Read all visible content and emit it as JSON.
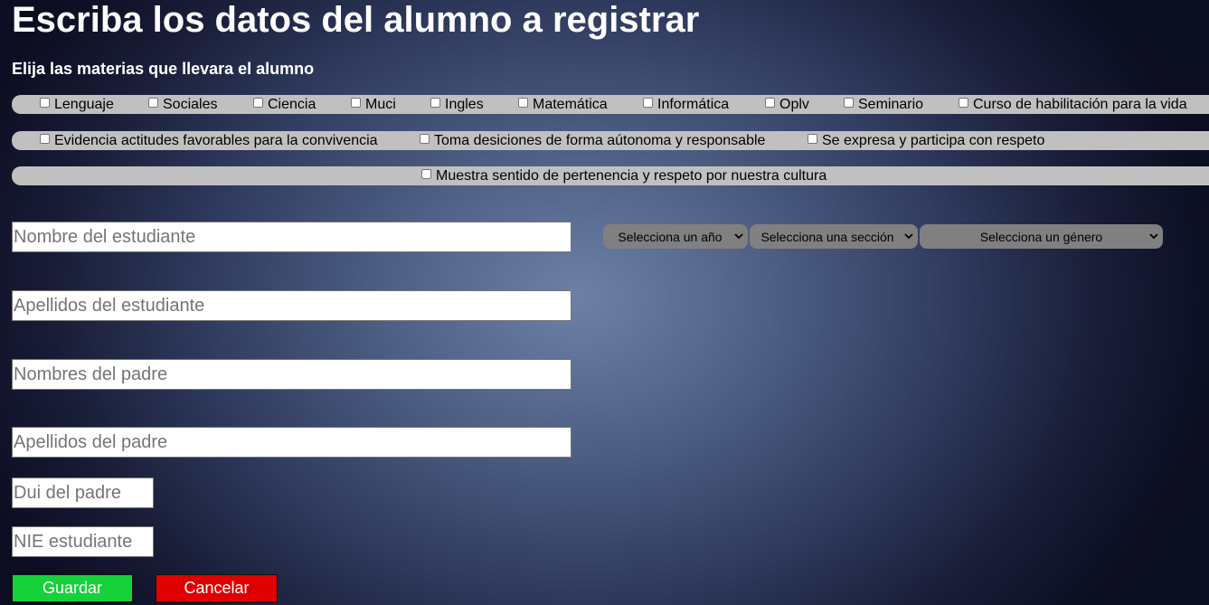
{
  "page": {
    "title": "Escriba los datos del alumno a registrar",
    "subtitle": "Elija las materias que llevara el alumno"
  },
  "subjects": {
    "row1": [
      "Lenguaje",
      "Sociales",
      "Ciencia",
      "Muci",
      "Ingles",
      "Matemática",
      "Informática",
      "Oplv",
      "Seminario",
      "Curso de habilitación para la vida"
    ],
    "row2": [
      "Evidencia actitudes favorables para la convivencia",
      "Toma desiciones de forma aútonoma y responsable",
      "Se expresa y participa con respeto"
    ],
    "row3": [
      "Muestra sentido de pertenencia y respeto por nuestra cultura"
    ]
  },
  "form": {
    "student_name_placeholder": "Nombre del estudiante",
    "student_lastname_placeholder": "Apellidos del estudiante",
    "father_name_placeholder": "Nombres del padre",
    "father_lastname_placeholder": "Apellidos del padre",
    "dui_placeholder": "Dui del padre",
    "nie_placeholder": "NIE estudiante"
  },
  "selects": {
    "year": "Selecciona un año",
    "section": "Selecciona una sección",
    "gender": "Selecciona un género"
  },
  "buttons": {
    "save": "Guardar",
    "cancel": "Cancelar"
  },
  "colors": {
    "save": "#17d13a",
    "cancel": "#e10000",
    "subject_bar": "#c0c0c0",
    "select": "#808080"
  }
}
